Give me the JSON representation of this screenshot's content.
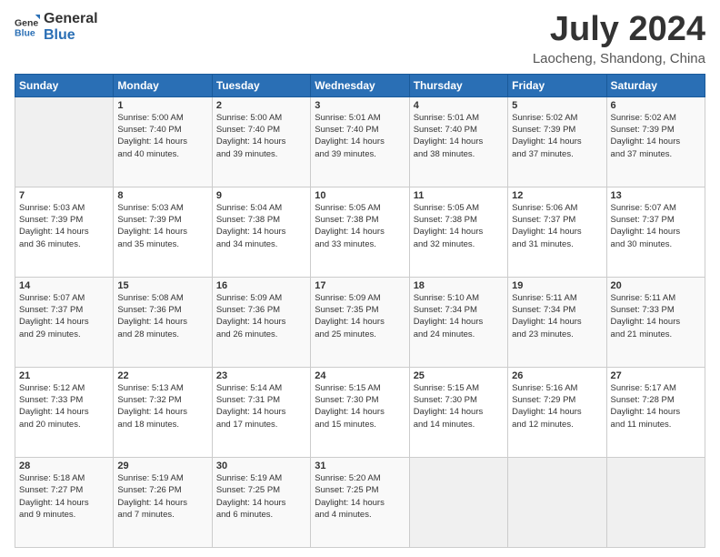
{
  "logo": {
    "general": "General",
    "blue": "Blue"
  },
  "title": "July 2024",
  "location": "Laocheng, Shandong, China",
  "days_header": [
    "Sunday",
    "Monday",
    "Tuesday",
    "Wednesday",
    "Thursday",
    "Friday",
    "Saturday"
  ],
  "weeks": [
    [
      {
        "day": "",
        "info": ""
      },
      {
        "day": "1",
        "info": "Sunrise: 5:00 AM\nSunset: 7:40 PM\nDaylight: 14 hours\nand 40 minutes."
      },
      {
        "day": "2",
        "info": "Sunrise: 5:00 AM\nSunset: 7:40 PM\nDaylight: 14 hours\nand 39 minutes."
      },
      {
        "day": "3",
        "info": "Sunrise: 5:01 AM\nSunset: 7:40 PM\nDaylight: 14 hours\nand 39 minutes."
      },
      {
        "day": "4",
        "info": "Sunrise: 5:01 AM\nSunset: 7:40 PM\nDaylight: 14 hours\nand 38 minutes."
      },
      {
        "day": "5",
        "info": "Sunrise: 5:02 AM\nSunset: 7:39 PM\nDaylight: 14 hours\nand 37 minutes."
      },
      {
        "day": "6",
        "info": "Sunrise: 5:02 AM\nSunset: 7:39 PM\nDaylight: 14 hours\nand 37 minutes."
      }
    ],
    [
      {
        "day": "7",
        "info": "Sunrise: 5:03 AM\nSunset: 7:39 PM\nDaylight: 14 hours\nand 36 minutes."
      },
      {
        "day": "8",
        "info": "Sunrise: 5:03 AM\nSunset: 7:39 PM\nDaylight: 14 hours\nand 35 minutes."
      },
      {
        "day": "9",
        "info": "Sunrise: 5:04 AM\nSunset: 7:38 PM\nDaylight: 14 hours\nand 34 minutes."
      },
      {
        "day": "10",
        "info": "Sunrise: 5:05 AM\nSunset: 7:38 PM\nDaylight: 14 hours\nand 33 minutes."
      },
      {
        "day": "11",
        "info": "Sunrise: 5:05 AM\nSunset: 7:38 PM\nDaylight: 14 hours\nand 32 minutes."
      },
      {
        "day": "12",
        "info": "Sunrise: 5:06 AM\nSunset: 7:37 PM\nDaylight: 14 hours\nand 31 minutes."
      },
      {
        "day": "13",
        "info": "Sunrise: 5:07 AM\nSunset: 7:37 PM\nDaylight: 14 hours\nand 30 minutes."
      }
    ],
    [
      {
        "day": "14",
        "info": "Sunrise: 5:07 AM\nSunset: 7:37 PM\nDaylight: 14 hours\nand 29 minutes."
      },
      {
        "day": "15",
        "info": "Sunrise: 5:08 AM\nSunset: 7:36 PM\nDaylight: 14 hours\nand 28 minutes."
      },
      {
        "day": "16",
        "info": "Sunrise: 5:09 AM\nSunset: 7:36 PM\nDaylight: 14 hours\nand 26 minutes."
      },
      {
        "day": "17",
        "info": "Sunrise: 5:09 AM\nSunset: 7:35 PM\nDaylight: 14 hours\nand 25 minutes."
      },
      {
        "day": "18",
        "info": "Sunrise: 5:10 AM\nSunset: 7:34 PM\nDaylight: 14 hours\nand 24 minutes."
      },
      {
        "day": "19",
        "info": "Sunrise: 5:11 AM\nSunset: 7:34 PM\nDaylight: 14 hours\nand 23 minutes."
      },
      {
        "day": "20",
        "info": "Sunrise: 5:11 AM\nSunset: 7:33 PM\nDaylight: 14 hours\nand 21 minutes."
      }
    ],
    [
      {
        "day": "21",
        "info": "Sunrise: 5:12 AM\nSunset: 7:33 PM\nDaylight: 14 hours\nand 20 minutes."
      },
      {
        "day": "22",
        "info": "Sunrise: 5:13 AM\nSunset: 7:32 PM\nDaylight: 14 hours\nand 18 minutes."
      },
      {
        "day": "23",
        "info": "Sunrise: 5:14 AM\nSunset: 7:31 PM\nDaylight: 14 hours\nand 17 minutes."
      },
      {
        "day": "24",
        "info": "Sunrise: 5:15 AM\nSunset: 7:30 PM\nDaylight: 14 hours\nand 15 minutes."
      },
      {
        "day": "25",
        "info": "Sunrise: 5:15 AM\nSunset: 7:30 PM\nDaylight: 14 hours\nand 14 minutes."
      },
      {
        "day": "26",
        "info": "Sunrise: 5:16 AM\nSunset: 7:29 PM\nDaylight: 14 hours\nand 12 minutes."
      },
      {
        "day": "27",
        "info": "Sunrise: 5:17 AM\nSunset: 7:28 PM\nDaylight: 14 hours\nand 11 minutes."
      }
    ],
    [
      {
        "day": "28",
        "info": "Sunrise: 5:18 AM\nSunset: 7:27 PM\nDaylight: 14 hours\nand 9 minutes."
      },
      {
        "day": "29",
        "info": "Sunrise: 5:19 AM\nSunset: 7:26 PM\nDaylight: 14 hours\nand 7 minutes."
      },
      {
        "day": "30",
        "info": "Sunrise: 5:19 AM\nSunset: 7:25 PM\nDaylight: 14 hours\nand 6 minutes."
      },
      {
        "day": "31",
        "info": "Sunrise: 5:20 AM\nSunset: 7:25 PM\nDaylight: 14 hours\nand 4 minutes."
      },
      {
        "day": "",
        "info": ""
      },
      {
        "day": "",
        "info": ""
      },
      {
        "day": "",
        "info": ""
      }
    ]
  ]
}
